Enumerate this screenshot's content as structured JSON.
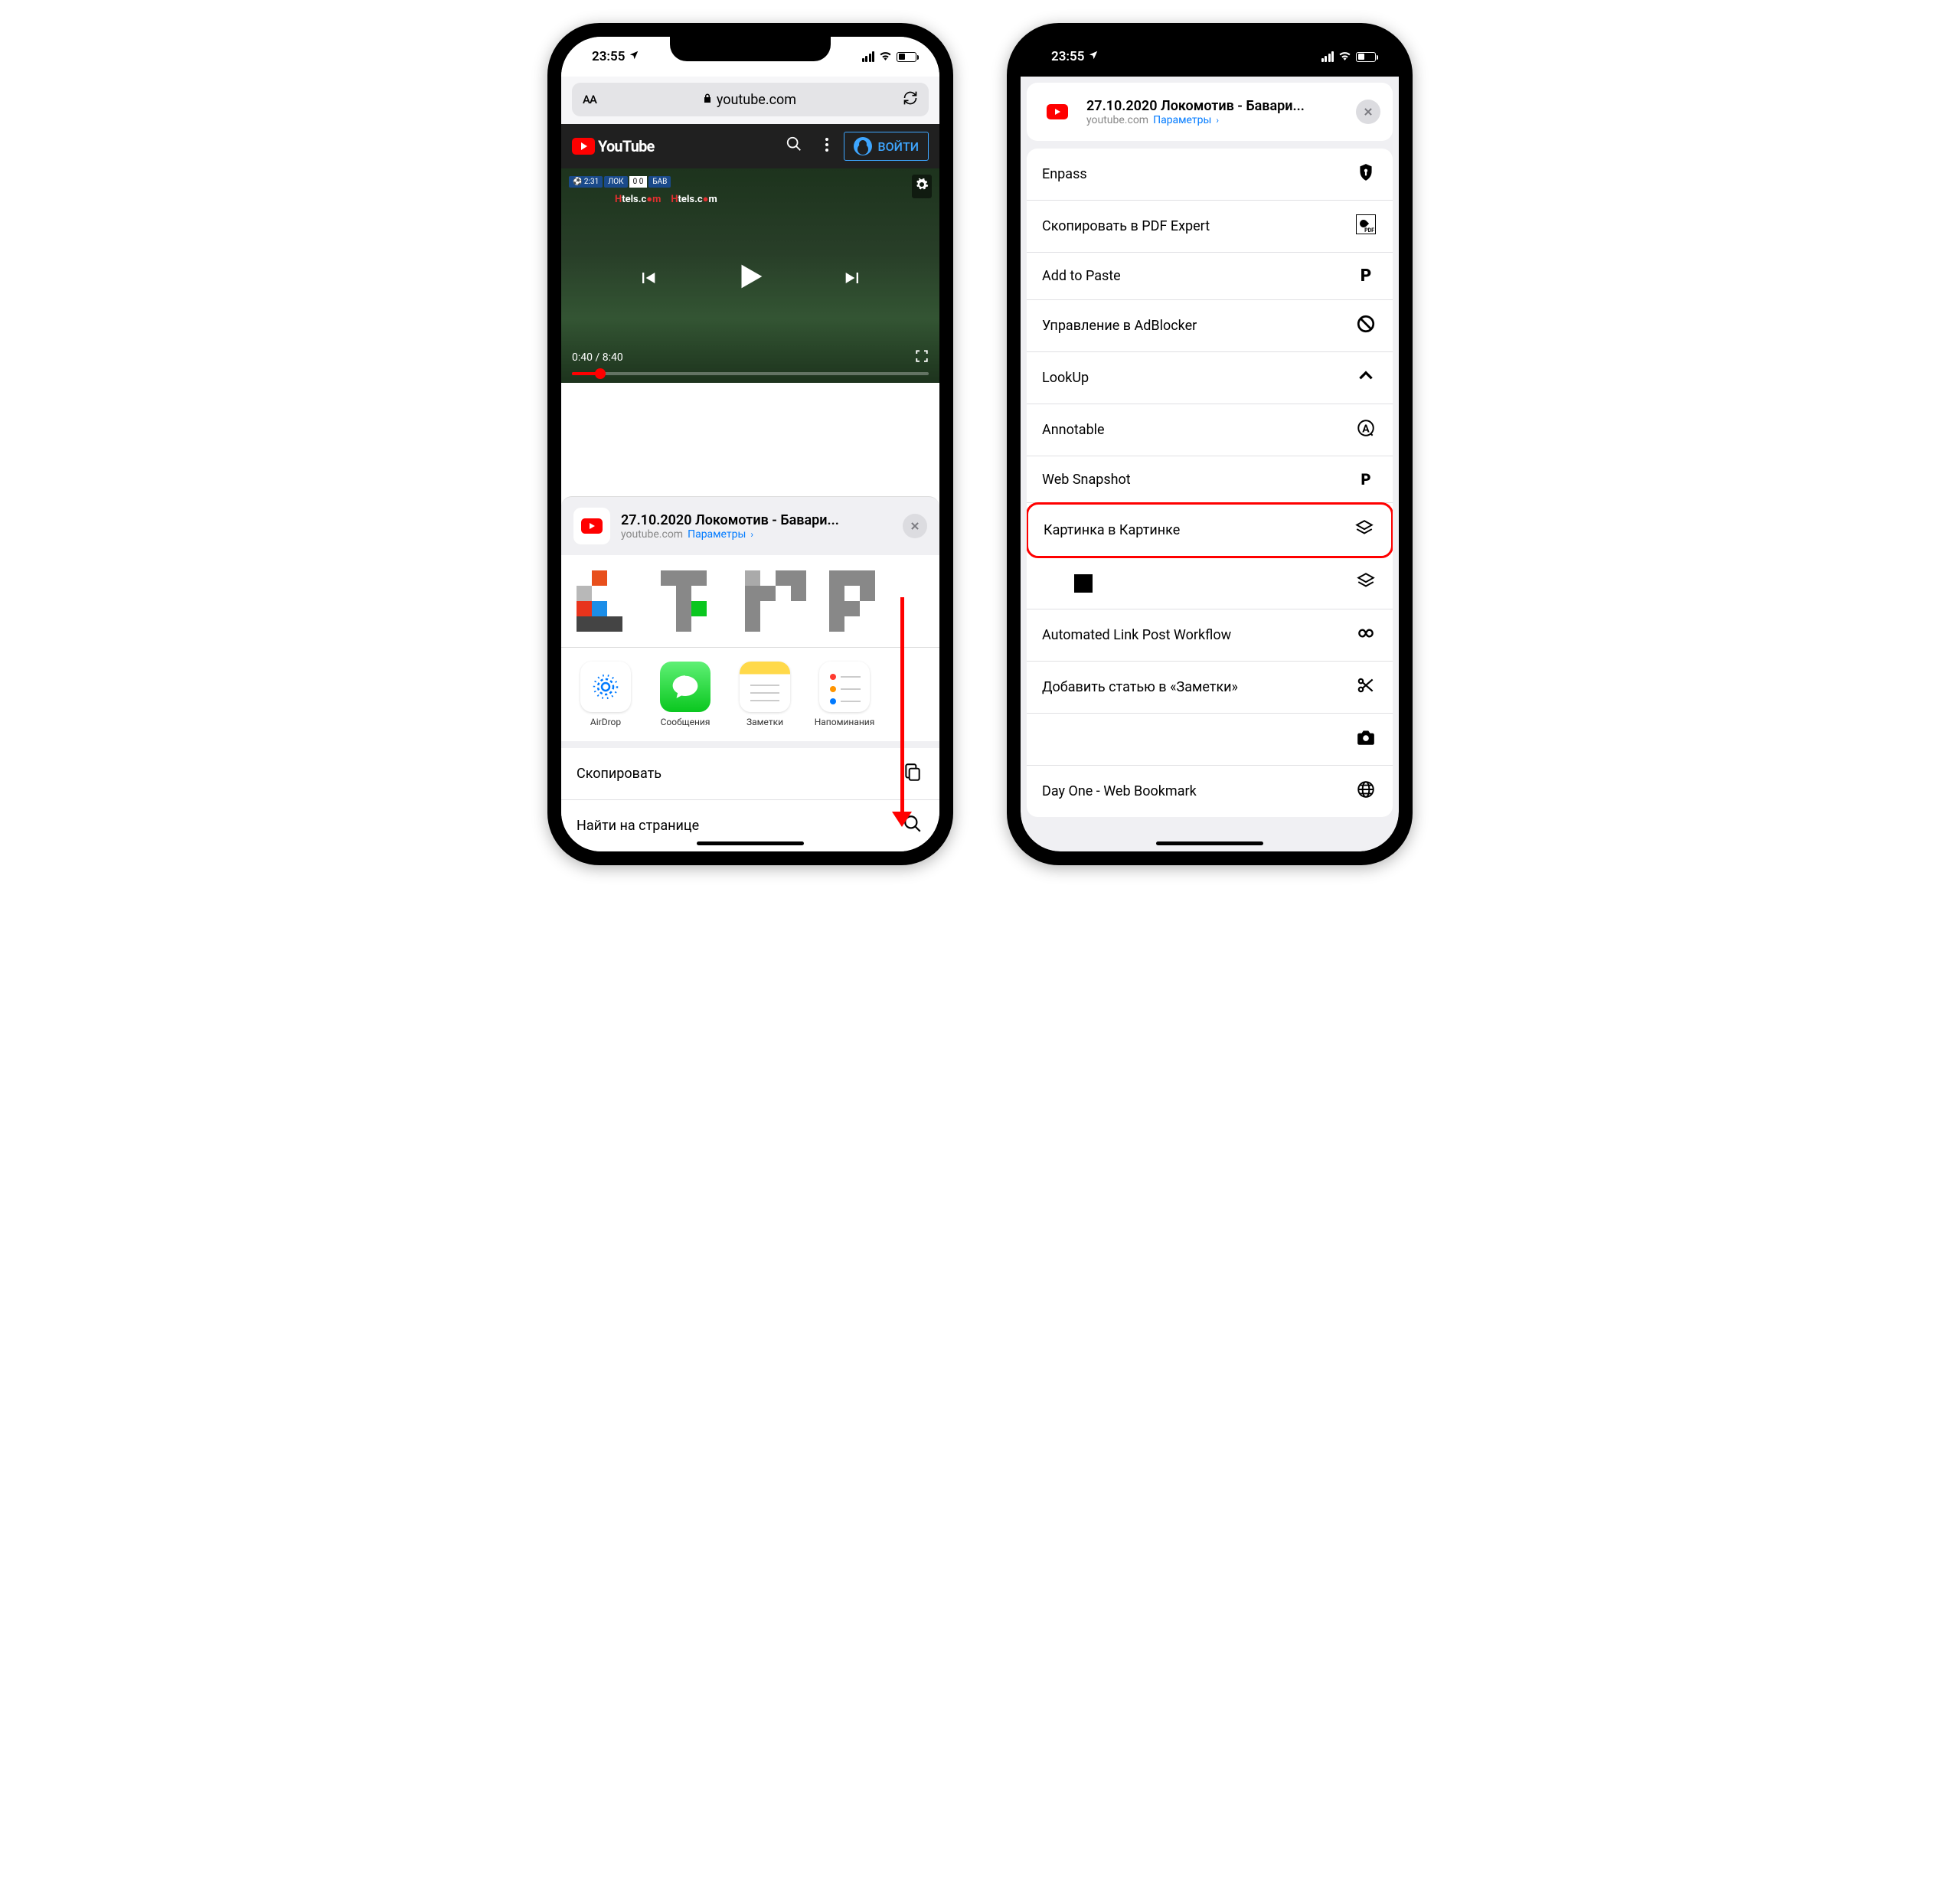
{
  "status": {
    "time": "23:55",
    "location_arrow": "➤"
  },
  "url_bar": {
    "domain": "youtube.com"
  },
  "youtube": {
    "brand": "YouTube",
    "signin": "ВОЙТИ"
  },
  "video": {
    "current_time": "0:40",
    "total_time": "8:40",
    "scoreboard_left": "ЛОК",
    "scoreboard_score": "0   0",
    "scoreboard_right": "БАВ",
    "ad_text_prefix": "H",
    "ad_text": "tels.c",
    "ad_text2": "m"
  },
  "share_header": {
    "title": "27.10.2020 Локомотив - Бавари...",
    "domain": "youtube.com",
    "params": "Параметры"
  },
  "apps": {
    "airdrop": "AirDrop",
    "messages": "Сообщения",
    "notes": "Заметки",
    "reminders": "Напоминания"
  },
  "left_actions": {
    "copy": "Скопировать",
    "find": "Найти на странице"
  },
  "right_actions": {
    "enpass": "Enpass",
    "pdf_expert": "Скопировать в PDF Expert",
    "paste": "Add to Paste",
    "adblocker": "Управление в AdBlocker",
    "lookup": "LookUp",
    "annotable": "Annotable",
    "web_snapshot": "Web Snapshot",
    "pip": "Картинка в Картинке",
    "auto_link": "Automated Link Post Workflow",
    "add_notes": "Добавить статью в «Заметки»",
    "dayone": "Day One - Web Bookmark"
  }
}
